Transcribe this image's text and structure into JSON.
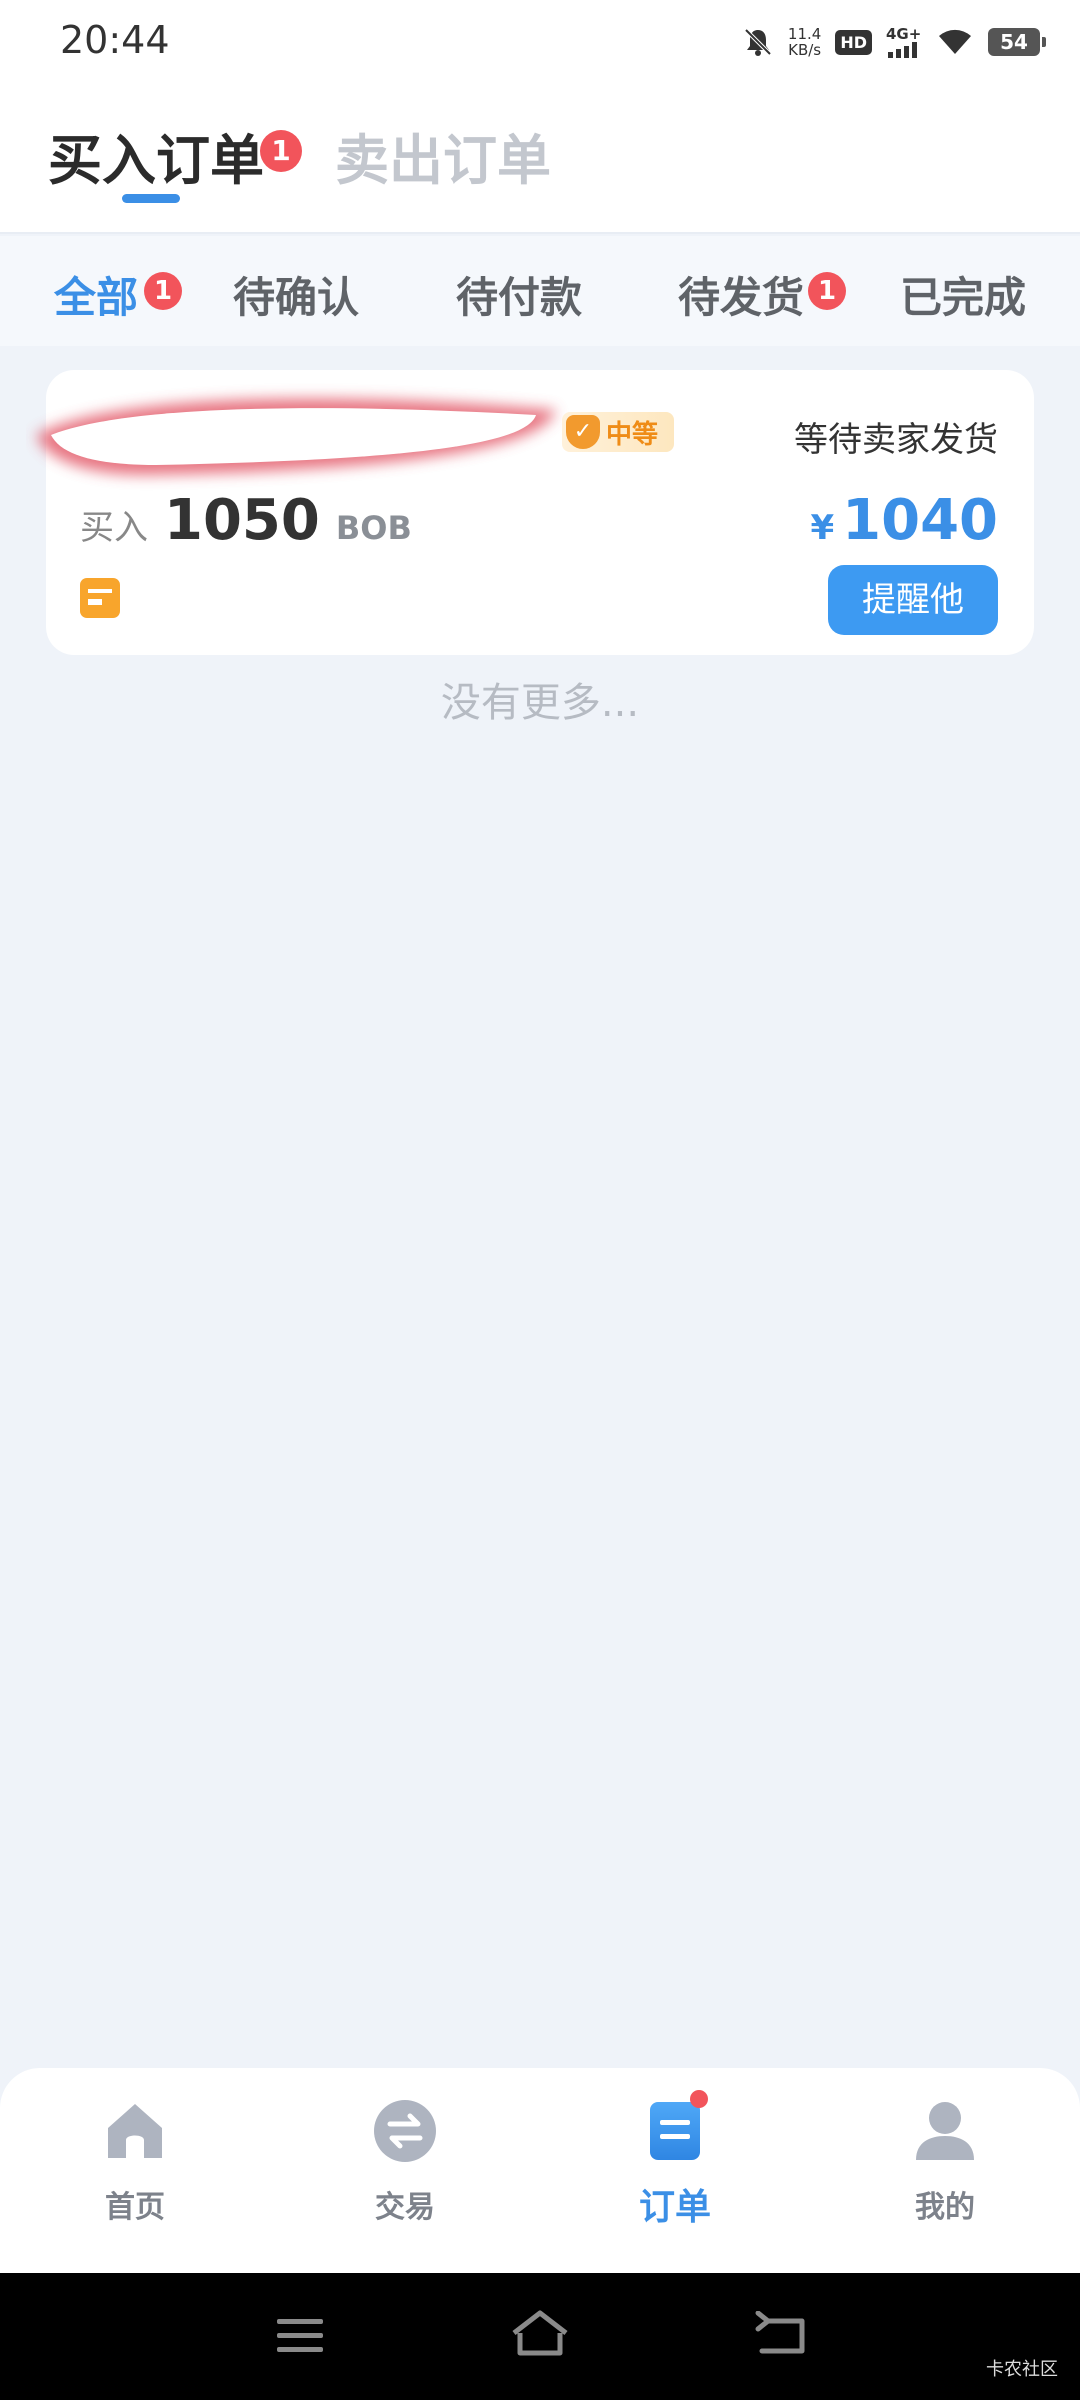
{
  "status_bar": {
    "time": "20:44",
    "speed_value": "11.4",
    "speed_unit": "KB/s",
    "hd": "HD",
    "network": "4G+",
    "battery": "54"
  },
  "header": {
    "tabs": [
      {
        "label": "买入订单",
        "badge": "1"
      },
      {
        "label": "卖出订单"
      }
    ]
  },
  "filters": [
    {
      "label": "全部",
      "badge": "1"
    },
    {
      "label": "待确认"
    },
    {
      "label": "待付款"
    },
    {
      "label": "待发货",
      "badge": "1"
    },
    {
      "label": "已完成"
    }
  ],
  "order": {
    "level": "中等",
    "status": "等待卖家发货",
    "buy_label": "买入",
    "amount": "1050",
    "unit": "BOB",
    "currency": "¥",
    "price": "1040",
    "remind_label": "提醒他"
  },
  "no_more": "没有更多...",
  "tabbar": {
    "items": [
      {
        "label": "首页",
        "icon": "home-icon"
      },
      {
        "label": "交易",
        "icon": "exchange-icon"
      },
      {
        "label": "订单",
        "icon": "orders-icon"
      },
      {
        "label": "我的",
        "icon": "profile-icon"
      }
    ]
  },
  "watermark": "卡农社区",
  "colors": {
    "accent": "#3b8fe6",
    "badge": "#f2545b",
    "background": "#eff3f9"
  }
}
